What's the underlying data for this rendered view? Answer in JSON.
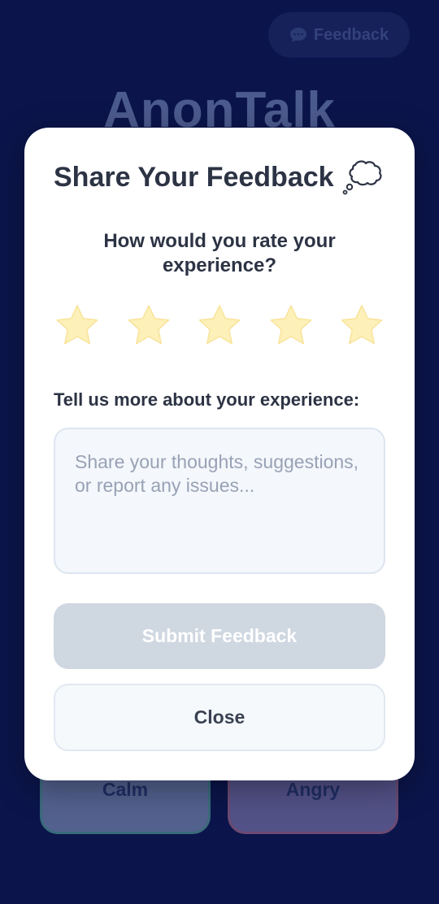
{
  "header": {
    "feedback_button_label": "Feedback",
    "feedback_icon": "speech-bubble-icon"
  },
  "app": {
    "title": "AnonTalk"
  },
  "moods": [
    {
      "label": "Calm"
    },
    {
      "label": "Angry"
    }
  ],
  "modal": {
    "title": "Share Your Feedback",
    "title_icon": "thought-bubble-icon",
    "rating_question": "How would you rate your experience?",
    "rating": {
      "max": 5,
      "selected": 0
    },
    "details_label": "Tell us more about your experience:",
    "textarea": {
      "value": "",
      "placeholder": "Share your thoughts, suggestions, or report any issues..."
    },
    "submit_label": "Submit Feedback",
    "submit_disabled": true,
    "close_label": "Close"
  },
  "colors": {
    "background": "#0b154b",
    "modal_bg": "#ffffff",
    "star_fill": "#fdf0b8",
    "submit_disabled_bg": "#cfd7e1",
    "text_dark": "#2c3344"
  }
}
